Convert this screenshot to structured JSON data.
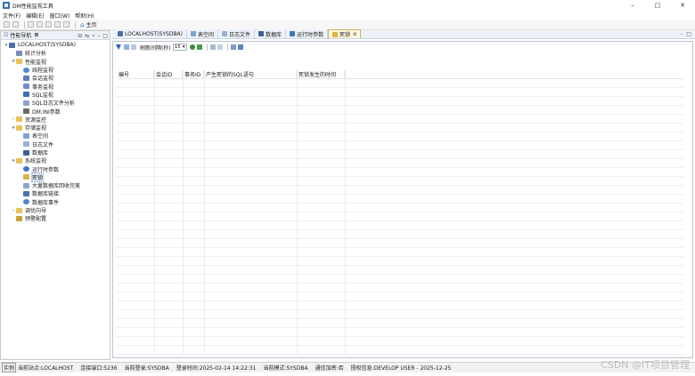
{
  "window": {
    "title": "DM性能监视工具",
    "minimize": "–",
    "maximize": "□",
    "close": "✕"
  },
  "menu": [
    "文件(F)",
    "编辑(E)",
    "窗口(W)",
    "帮助(H)"
  ],
  "toolbar": {
    "home_label": "主页"
  },
  "navigator": {
    "title": "性能导航",
    "tab_suffix": "⊠",
    "tree": [
      {
        "label": "LOCALHOST(SYSDBA)",
        "icon": "server-icon",
        "expander": "▾"
      },
      {
        "label": "统计分析",
        "icon": "statistics-icon",
        "expander": ""
      },
      {
        "label": "性能监视",
        "icon": "folder-icon",
        "expander": "▾"
      },
      {
        "label": "线程监视",
        "icon": "thread-monitor-icon",
        "expander": ""
      },
      {
        "label": "会话监视",
        "icon": "session-monitor-icon",
        "expander": ""
      },
      {
        "label": "事务监视",
        "icon": "transaction-monitor-icon",
        "expander": ""
      },
      {
        "label": "SQL监视",
        "icon": "sql-monitor-icon",
        "expander": ""
      },
      {
        "label": "SQL日志文件分析",
        "icon": "sql-log-icon",
        "expander": ""
      },
      {
        "label": "DM.INI参数",
        "icon": "dmini-icon",
        "expander": ""
      },
      {
        "label": "资源监控",
        "icon": "folder-icon",
        "expander": "›"
      },
      {
        "label": "存储监视",
        "icon": "folder-icon",
        "expander": "▾"
      },
      {
        "label": "表空间",
        "icon": "tablespace-icon",
        "expander": ""
      },
      {
        "label": "日志文件",
        "icon": "logfile-icon",
        "expander": ""
      },
      {
        "label": "数据库",
        "icon": "database-icon",
        "expander": ""
      },
      {
        "label": "系统监视",
        "icon": "folder-icon",
        "expander": "▾"
      },
      {
        "label": "运行时参数",
        "icon": "runtime-param-icon",
        "expander": ""
      },
      {
        "label": "死锁",
        "icon": "deadlock-icon",
        "expander": ""
      },
      {
        "label": "大量数据库回收完美",
        "icon": "undo-icon",
        "expander": ""
      },
      {
        "label": "数据库链接",
        "icon": "dblink-icon",
        "expander": ""
      },
      {
        "label": "数据库事件",
        "icon": "db-event-icon",
        "expander": ""
      },
      {
        "label": "调优向导",
        "icon": "folder-icon",
        "expander": "›"
      },
      {
        "label": "预警配置",
        "icon": "alert-config-icon",
        "expander": ""
      }
    ]
  },
  "tabs": [
    {
      "label": "LOCALHOST(SYSDBA)",
      "icon": "server-icon"
    },
    {
      "label": "表空间",
      "icon": "tablespace-icon"
    },
    {
      "label": "日志文件",
      "icon": "logfile-icon"
    },
    {
      "label": "数据库",
      "icon": "database-icon"
    },
    {
      "label": "运行时参数",
      "icon": "runtime-param-icon"
    },
    {
      "label": "死锁",
      "icon": "deadlock-icon",
      "active": true,
      "close": "⊠"
    }
  ],
  "deadlock_view": {
    "refresh_label": "刷新间隔(秒)",
    "refresh_value": "15",
    "columns": [
      "编号",
      "会话ID",
      "事务ID",
      "产生死锁的SQL语句",
      "死锁发生的时间"
    ]
  },
  "statusbar": {
    "mode_badge": "实例",
    "site": "当前站点:LOCALHOST",
    "port": "连接端口:5236",
    "login": "当前登录:SYSDBA",
    "login_time": "登录时间:2025-02-14 14:22:31",
    "server_mode": "当前模式:SYSDBA",
    "encrypt": "通信加密:否",
    "license": "授权信息:DEVELOP USER - 2025-12-25"
  },
  "watermark": "CSDN @IT项目管理",
  "colors": {
    "accent": "#2a64b5",
    "active_tab": "#fff8dc",
    "folder": "#e8c25a"
  }
}
